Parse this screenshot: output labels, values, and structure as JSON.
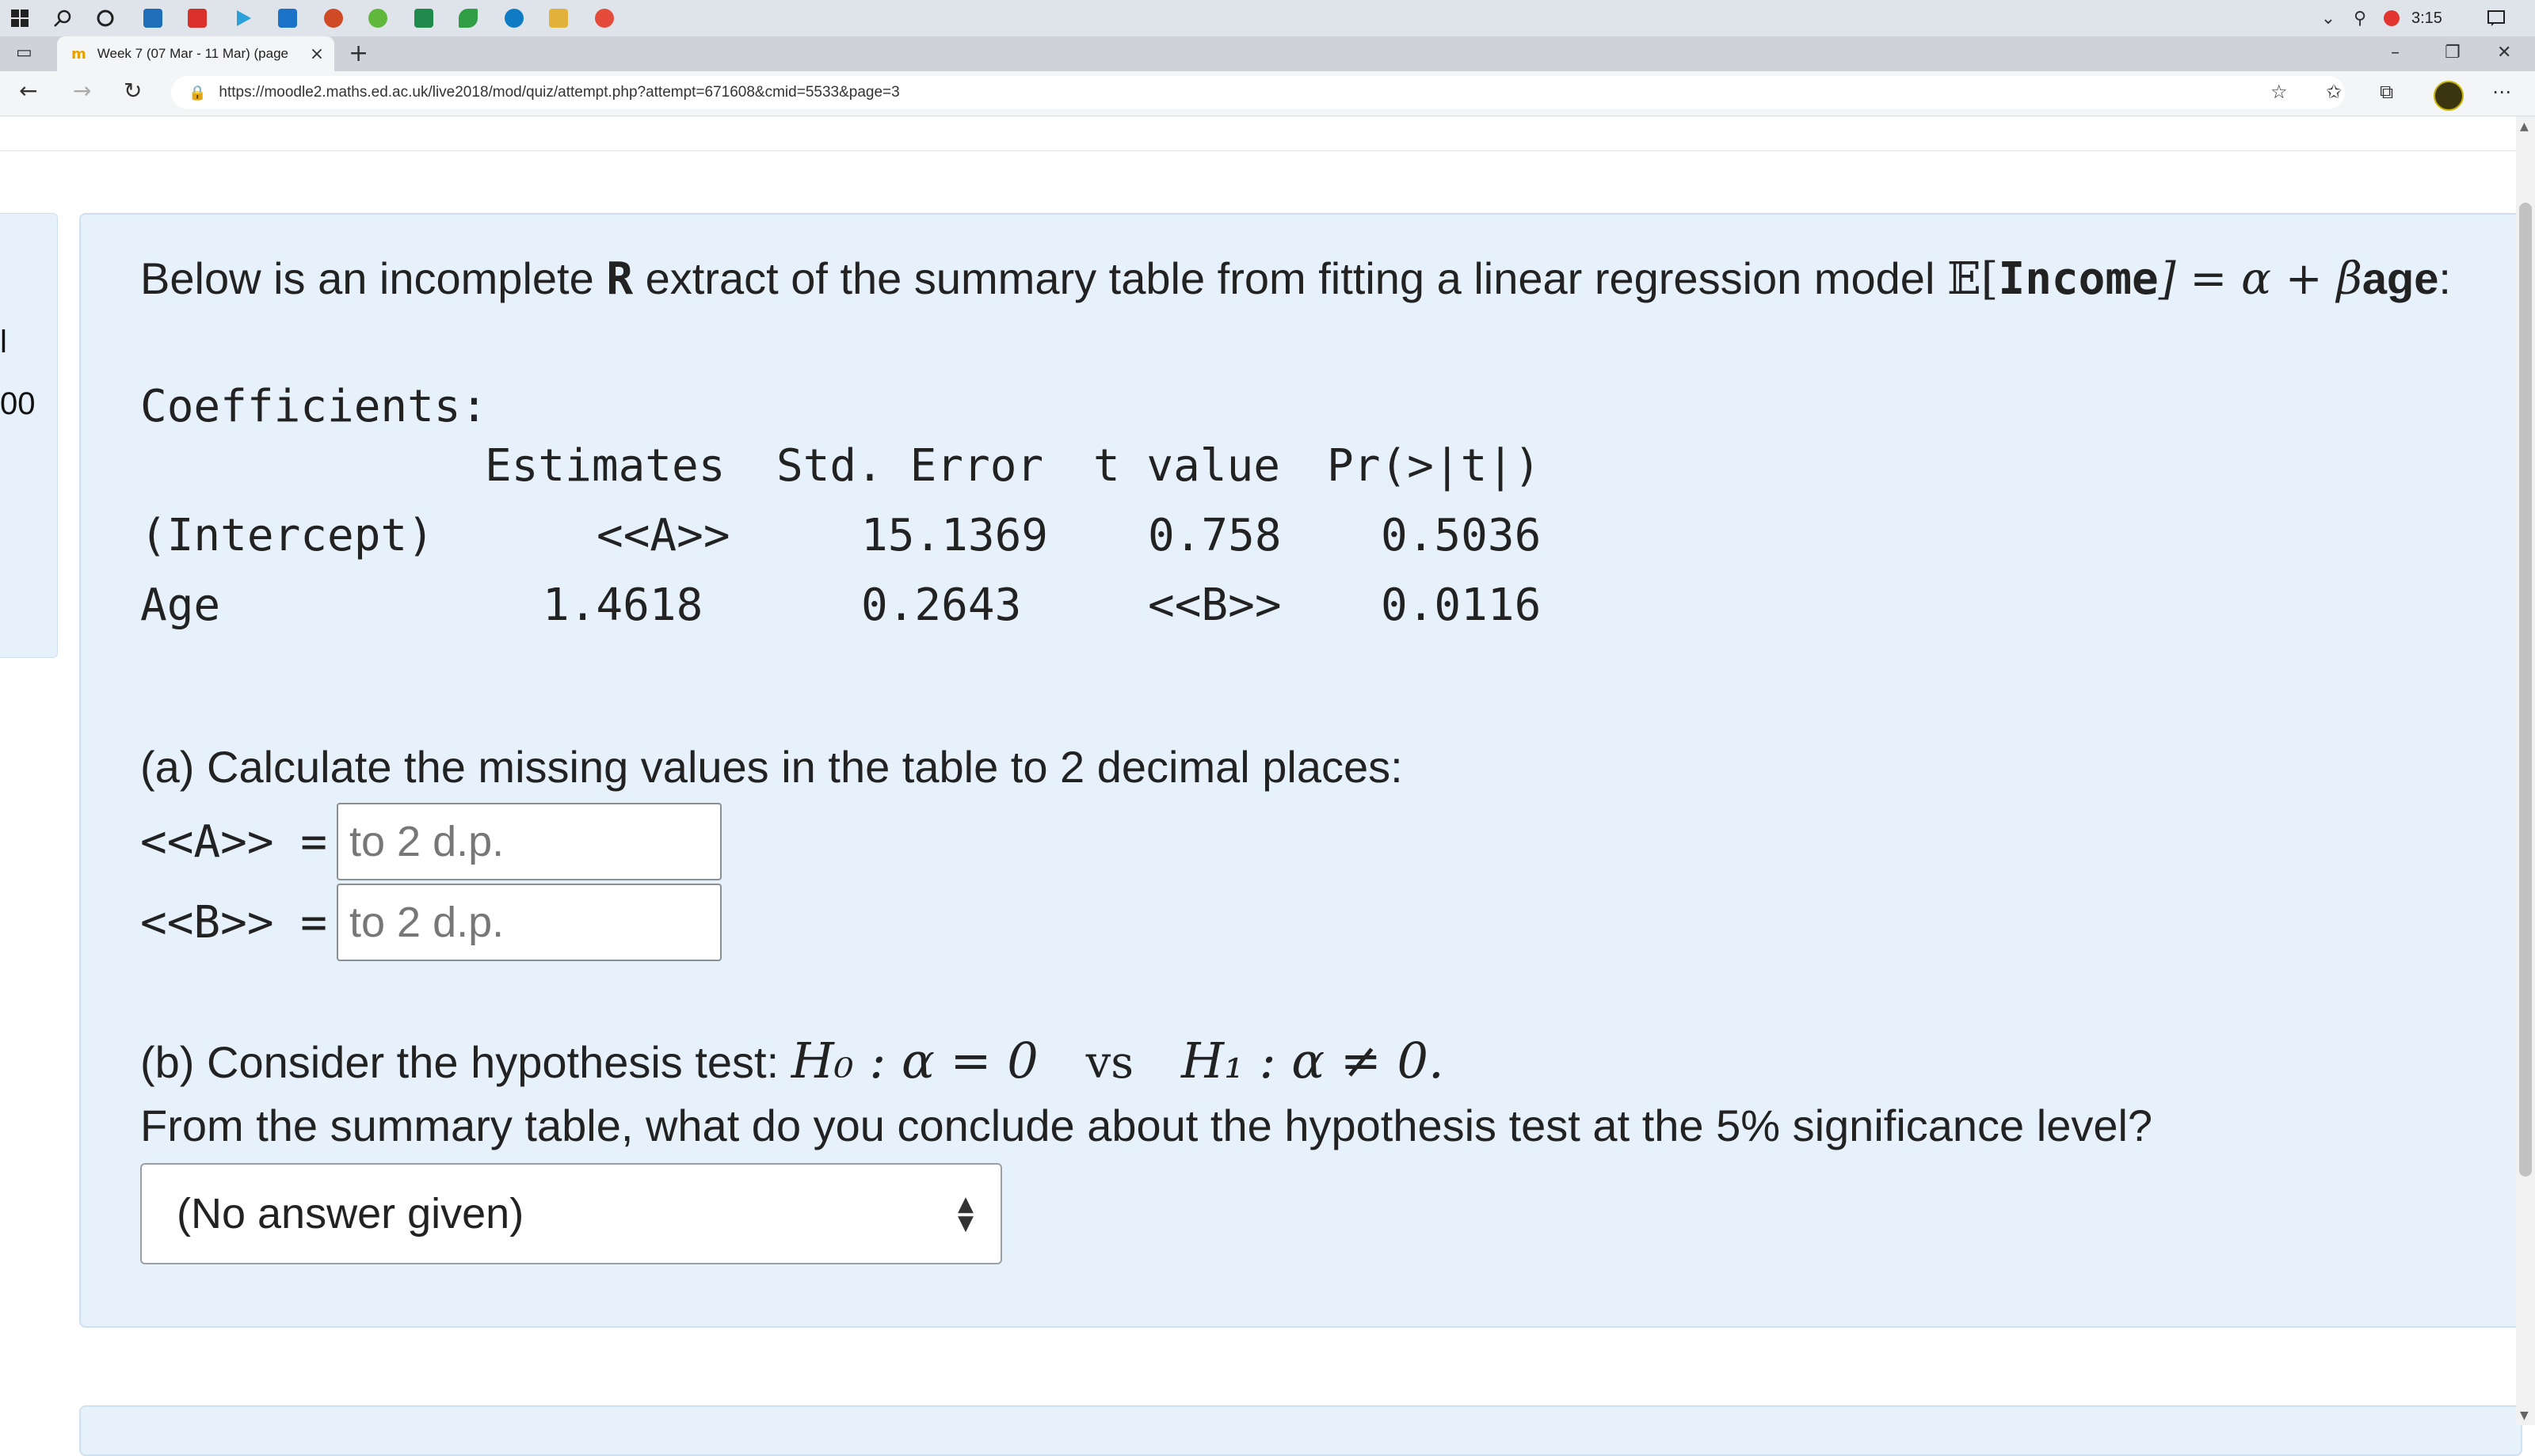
{
  "taskbar": {
    "clock": "3:15",
    "icons": [
      "windows-start-icon",
      "search-icon",
      "cortana-icon",
      "store-icon",
      "pdf-icon",
      "media-player-icon",
      "mail-icon",
      "powerpoint-icon",
      "evernote-icon",
      "excel-icon",
      "leaf-icon",
      "edge-icon",
      "file-explorer-icon",
      "chrome-icon"
    ]
  },
  "browser": {
    "tab_title": "Week 7 (07 Mar - 11 Mar) (page",
    "url": "https://moodle2.maths.ed.ac.uk/live2018/mod/quiz/attempt.php?attempt=671608&cmid=5533&page=3"
  },
  "sidebar_partial": {
    "line1": "l",
    "line2": "00"
  },
  "question": {
    "intro_prefix": "Below is an incomplete ",
    "intro_R": "R",
    "intro_mid": " extract of the summary table from fitting a linear regression model ",
    "model_E": "𝔼[",
    "model_income": "Income",
    "model_rest": "] = α + β",
    "model_age": "age",
    "model_colon": ":",
    "coefficients_label": "Coefficients:",
    "table": {
      "headers": [
        "",
        "Estimates",
        "Std. Error",
        "t value",
        "Pr(>|t|)"
      ],
      "rows": [
        [
          "(Intercept)",
          "<<A>>",
          "15.1369",
          "0.758",
          "0.5036"
        ],
        [
          "Age",
          "1.4618",
          "0.2643",
          "<<B>>",
          "0.0116"
        ]
      ]
    },
    "part_a_text": "(a) Calculate the missing values in the table to 2 decimal places:",
    "answer_a_label": "<<A>> =",
    "answer_b_label": "<<B>> =",
    "input_placeholder": "to 2 d.p.",
    "part_b_prefix": "(b) Consider the hypothesis test: ",
    "h0": "H₀ : α = 0",
    "vs": "vs",
    "h1": "H₁ : α ≠ 0.",
    "part_b_question": "From the summary table, what do you conclude about the hypothesis test at the 5% significance level?",
    "select_value": "(No answer given)"
  }
}
